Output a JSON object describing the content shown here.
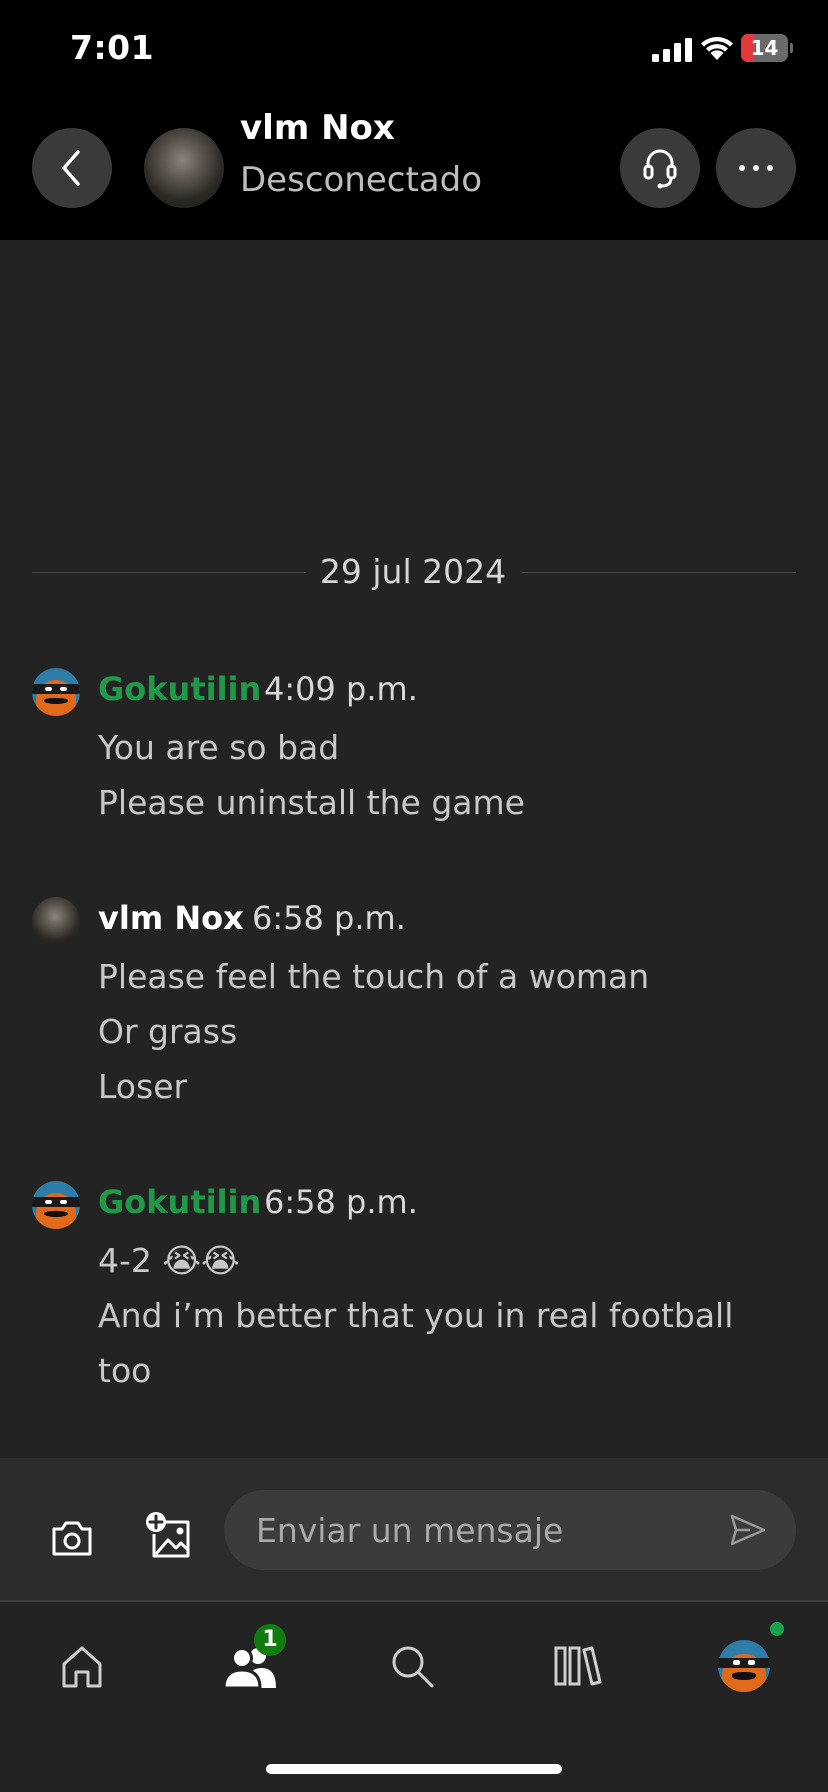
{
  "status_bar": {
    "time": "7:01",
    "battery": "14"
  },
  "header": {
    "contact_name": "vlm Nox",
    "contact_status": "Desconectado"
  },
  "date_divider": "29 jul 2024",
  "messages": [
    {
      "sender": "Gokutilin",
      "time": "4:09 p.m.",
      "lines": [
        "You are so bad",
        "Please uninstall the game"
      ]
    },
    {
      "sender": "vlm Nox",
      "time": "6:58 p.m.",
      "lines": [
        "Please feel the touch of a woman",
        "Or grass",
        "Loser"
      ]
    },
    {
      "sender": "Gokutilin",
      "time": "6:58 p.m.",
      "lines": [
        "4-2 😭😭",
        "And i’m better that you in real football",
        "too"
      ]
    }
  ],
  "composer": {
    "placeholder": "Enviar un mensaje"
  },
  "tabbar": {
    "friends_badge": "1"
  },
  "colors": {
    "accent_green": "#1f9a48",
    "badge_green": "#107c10",
    "background": "#232323"
  },
  "icons": [
    "back-icon",
    "headset-icon",
    "more-icon",
    "camera-icon",
    "add-image-icon",
    "send-icon",
    "home-icon",
    "friends-icon",
    "search-icon",
    "library-icon",
    "profile-avatar"
  ]
}
